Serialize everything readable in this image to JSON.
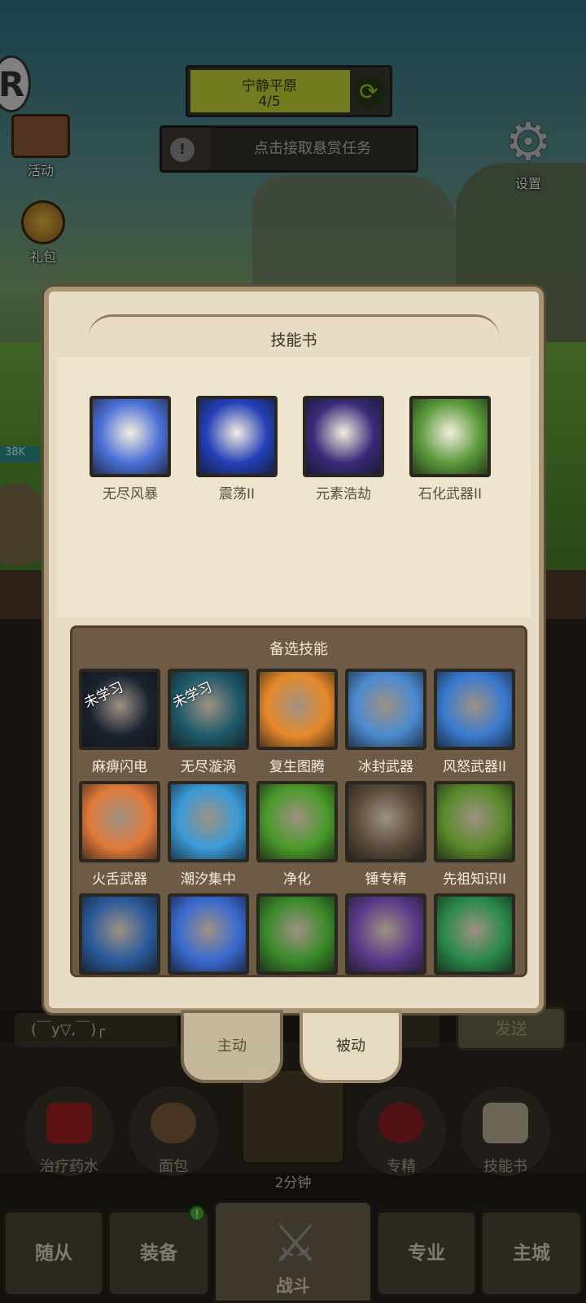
{
  "stage": {
    "name": "宁静平原",
    "progress": "4/5"
  },
  "bounty": {
    "label": "点击接取悬赏任务"
  },
  "hud": {
    "event_label": "活动",
    "gift_label": "礼包",
    "settings_label": "设置",
    "hp_value": "38K"
  },
  "chat": {
    "input_value": "(￣y▽,￣)╭",
    "send_label": "发送"
  },
  "consumables": [
    {
      "label": "治疗药水"
    },
    {
      "label": "面包"
    },
    {
      "label": "专精"
    },
    {
      "label": "技能书"
    }
  ],
  "chest": {
    "timer": "2分钟"
  },
  "nav": {
    "items": [
      {
        "label": "随从"
      },
      {
        "label": "装备"
      },
      {
        "label": "战斗"
      },
      {
        "label": "专业"
      },
      {
        "label": "主城"
      }
    ],
    "equipment_badge": "!"
  },
  "modal": {
    "title": "技能书",
    "alt_title": "备选技能",
    "unlearned_tag": "未学习",
    "equipped": [
      {
        "name": "无尽风暴",
        "color": "#4a6fd6"
      },
      {
        "name": "震荡II",
        "color": "#2440b8"
      },
      {
        "name": "元素浩劫",
        "color": "#3a2a7a"
      },
      {
        "name": "石化武器II",
        "color": "#5a9a3a"
      }
    ],
    "alternates": [
      {
        "name": "麻痹闪电",
        "color": "#1a2230",
        "unlearned": true
      },
      {
        "name": "无尽漩涡",
        "color": "#1f5a6a",
        "unlearned": true
      },
      {
        "name": "复生图腾",
        "color": "#e68a2a",
        "unlearned": false
      },
      {
        "name": "冰封武器",
        "color": "#4c8ad0",
        "unlearned": false
      },
      {
        "name": "风怒武器II",
        "color": "#3a7ad0",
        "unlearned": false
      },
      {
        "name": "火舌武器",
        "color": "#e07a3a",
        "unlearned": false
      },
      {
        "name": "潮汐集中",
        "color": "#3a9ad8",
        "unlearned": false
      },
      {
        "name": "净化",
        "color": "#4a9a2a",
        "unlearned": false
      },
      {
        "name": "锤专精",
        "color": "#5a4a3a",
        "unlearned": false
      },
      {
        "name": "先祖知识II",
        "color": "#5a8a2a",
        "unlearned": false
      },
      {
        "name": "",
        "color": "#2a5a9a",
        "unlearned": false
      },
      {
        "name": "",
        "color": "#3a6ad0",
        "unlearned": false
      },
      {
        "name": "",
        "color": "#3a8a2a",
        "unlearned": false
      },
      {
        "name": "",
        "color": "#5a3a8a",
        "unlearned": false
      },
      {
        "name": "",
        "color": "#2a8a4a",
        "unlearned": false
      }
    ]
  },
  "tabs": {
    "active": "主动",
    "passive": "被动"
  }
}
